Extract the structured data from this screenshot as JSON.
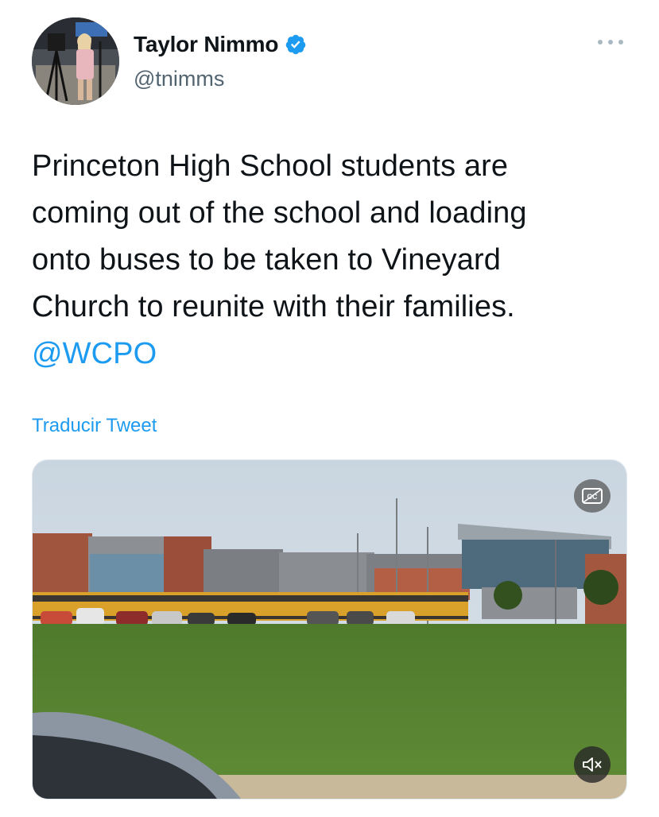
{
  "author": {
    "display_name": "Taylor Nimmo",
    "handle": "@tnimms",
    "verified": true
  },
  "tweet": {
    "lines": [
      "Princeton High School students are",
      "coming out of the school and loading",
      "onto buses to be taken to Vineyard",
      "Church to reunite with their families."
    ],
    "mention": "@WCPO"
  },
  "translate_label": "Traducir Tweet",
  "icons": {
    "verified": "verified-badge-icon",
    "more": "more-options-icon",
    "captions": "closed-captions-icon",
    "mute": "muted-speaker-icon"
  },
  "colors": {
    "accent": "#1d9bf0",
    "text": "#0f1419",
    "secondary": "#536471"
  }
}
